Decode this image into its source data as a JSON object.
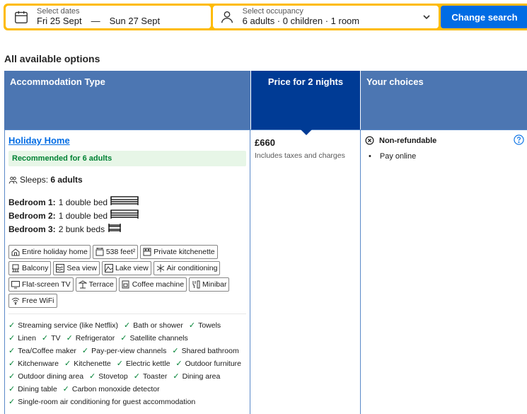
{
  "search": {
    "dates_label": "Select dates",
    "checkin": "Fri 25 Sept",
    "separator": "—",
    "checkout": "Sun 27 Sept",
    "occupancy_label": "Select occupancy",
    "occupancy_value": "6 adults · 0 children · 1 room",
    "change_button": "Change search"
  },
  "section_title": "All available options",
  "table": {
    "headers": {
      "type": "Accommodation Type",
      "price": "Price for 2 nights",
      "choices": "Your choices"
    },
    "room": {
      "name": "Holiday Home",
      "recommendation": "Recommended for 6 adults",
      "sleeps_label": "Sleeps:",
      "sleeps_value": "6 adults",
      "bedrooms": [
        {
          "label": "Bedroom 1:",
          "beds": "1 double bed"
        },
        {
          "label": "Bedroom 2:",
          "beds": "1 double bed"
        },
        {
          "label": "Bedroom 3:",
          "beds": "2 bunk beds"
        }
      ],
      "facilities": [
        {
          "label": "Entire holiday home",
          "icon": "house-icon"
        },
        {
          "label": "538 feet²",
          "icon": "area-icon"
        },
        {
          "label": "Private kitchenette",
          "icon": "kitchen-icon"
        },
        {
          "label": "Balcony",
          "icon": "balcony-icon"
        },
        {
          "label": "Sea view",
          "icon": "sea-view-icon"
        },
        {
          "label": "Lake view",
          "icon": "lake-view-icon"
        },
        {
          "label": "Air conditioning",
          "icon": "snowflake-icon"
        },
        {
          "label": "Flat-screen TV",
          "icon": "tv-icon"
        },
        {
          "label": "Terrace",
          "icon": "terrace-icon"
        },
        {
          "label": "Coffee machine",
          "icon": "coffee-icon"
        },
        {
          "label": "Minibar",
          "icon": "minibar-icon"
        },
        {
          "label": "Free WiFi",
          "icon": "wifi-icon"
        }
      ],
      "amenities": [
        "Streaming service (like Netflix)",
        "Bath or shower",
        "Towels",
        "Linen",
        "TV",
        "Refrigerator",
        "Satellite channels",
        "Tea/Coffee maker",
        "Pay-per-view channels",
        "Shared bathroom",
        "Kitchenware",
        "Kitchenette",
        "Electric kettle",
        "Outdoor furniture",
        "Outdoor dining area",
        "Stovetop",
        "Toaster",
        "Dining area",
        "Dining table",
        "Carbon monoxide detector",
        "Single-room air conditioning for guest accommodation"
      ]
    },
    "price": {
      "value": "£660",
      "note": "Includes taxes and charges"
    },
    "choices": {
      "policy": "Non-refundable",
      "items": [
        "Pay online"
      ]
    }
  },
  "colors": {
    "search_border": "#febb02",
    "button_blue": "#006ce4",
    "header_blue": "#4c76b2",
    "price_header": "#003b95",
    "green": "#008234"
  }
}
